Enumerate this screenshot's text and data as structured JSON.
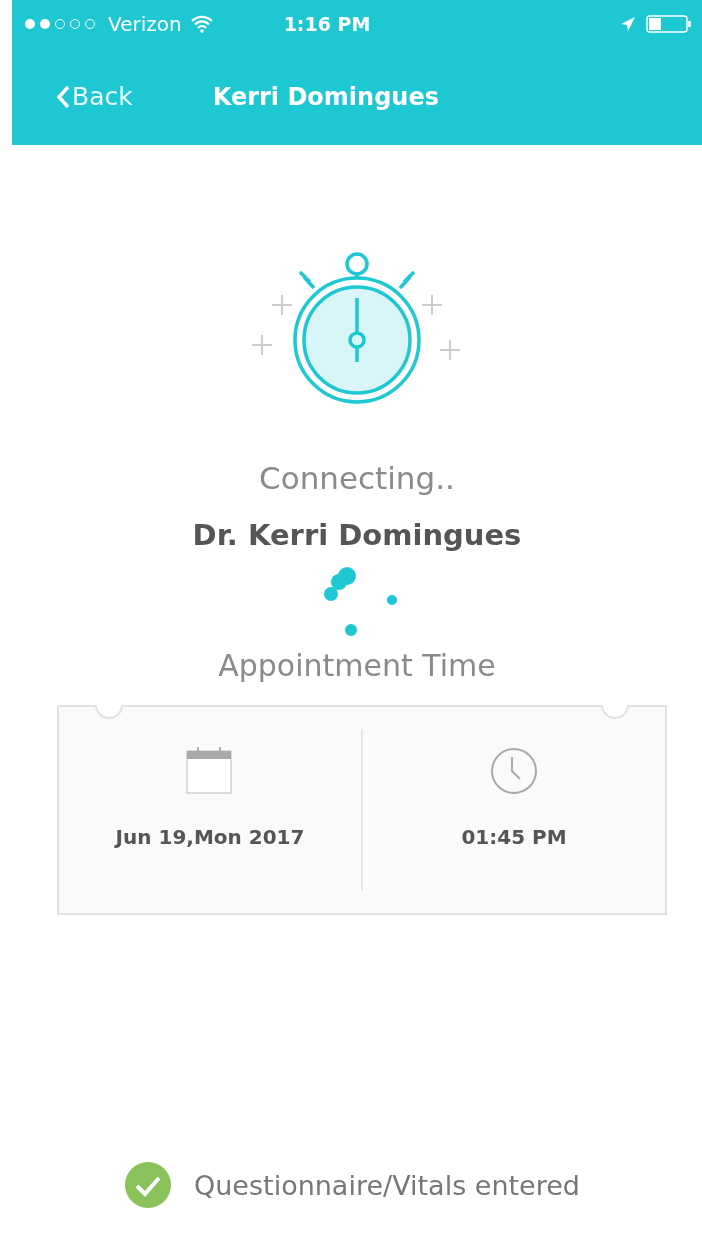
{
  "status_bar": {
    "carrier": "Verizon",
    "time": "1:16 PM"
  },
  "nav": {
    "back": "Back",
    "title": "Kerri Domingues"
  },
  "status": {
    "message": "Connecting..",
    "doctor": "Dr. Kerri Domingues"
  },
  "appointment": {
    "heading": "Appointment Time",
    "date": "Jun 19,Mon 2017",
    "time": "01:45 PM"
  },
  "checklist": [
    {
      "label": "Questionnaire/Vitals entered",
      "checked": true
    }
  ]
}
